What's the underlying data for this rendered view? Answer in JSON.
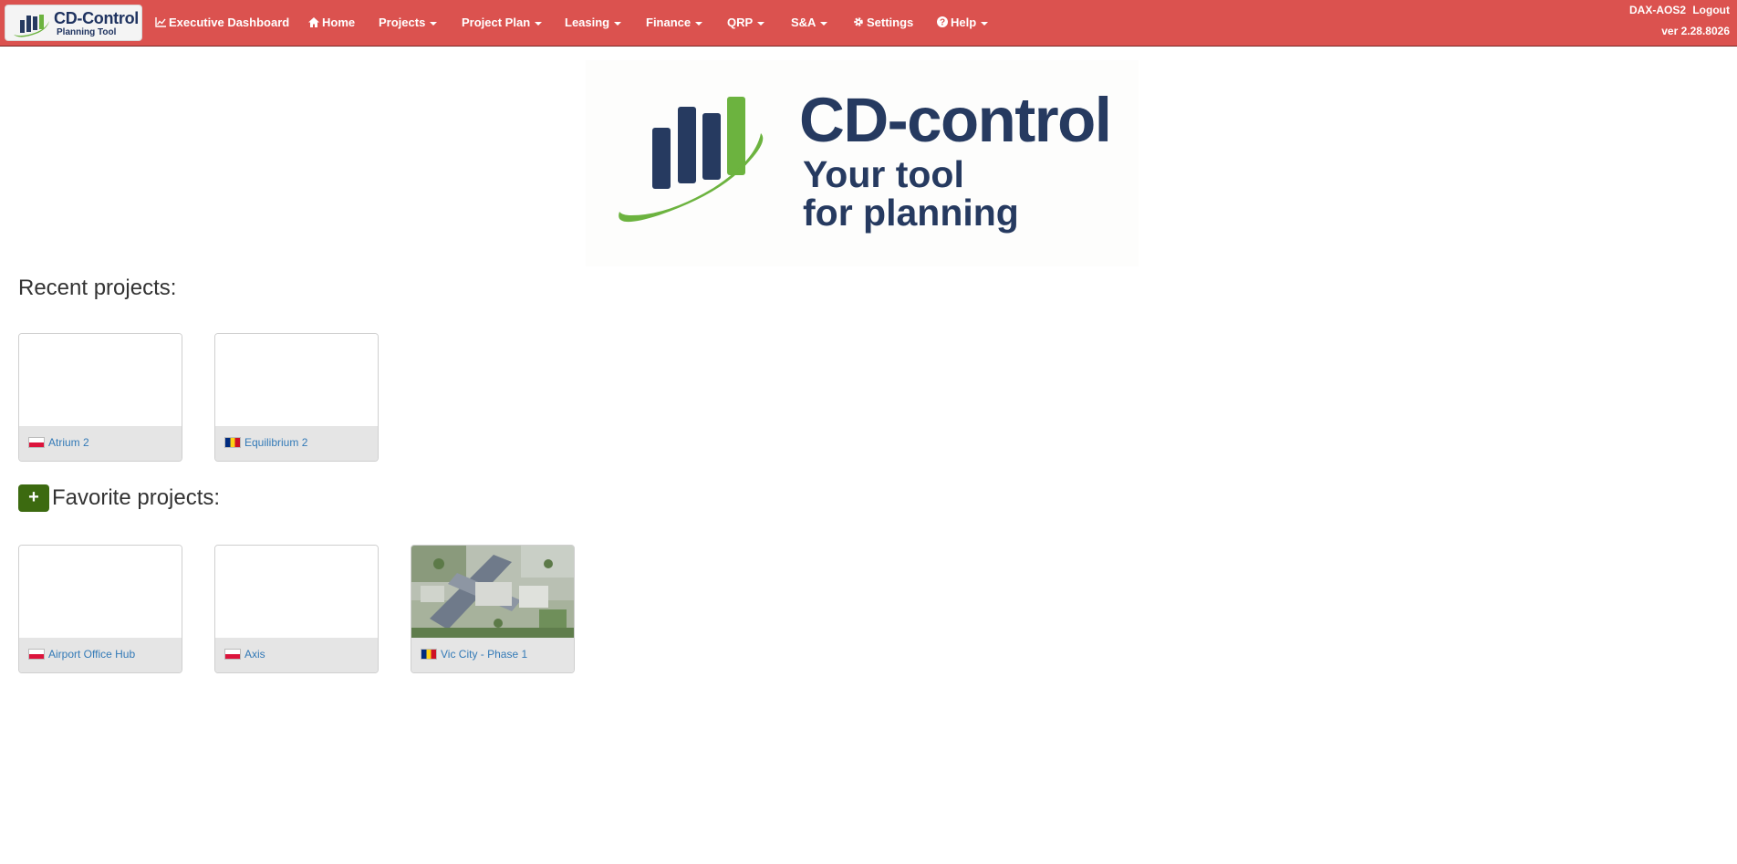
{
  "brand": {
    "title": "CD-Control",
    "subtitle": "Planning Tool"
  },
  "nav": {
    "items": [
      {
        "label": "Executive Dashboard",
        "icon": "chart-icon"
      },
      {
        "label": "Home",
        "icon": "home-icon"
      },
      {
        "label": "Projects",
        "dropdown": true
      },
      {
        "label": "Project Plan",
        "dropdown": true
      },
      {
        "label": "Leasing",
        "dropdown": true
      },
      {
        "label": "Finance",
        "dropdown": true
      },
      {
        "label": "QRP",
        "dropdown": true
      },
      {
        "label": "S&A",
        "dropdown": true
      },
      {
        "label": "Settings",
        "icon": "gear-icon"
      },
      {
        "label": "Help",
        "icon": "question-circle-icon",
        "dropdown": true
      }
    ],
    "user": "DAX-AOS2",
    "logout": "Logout",
    "version": "ver 2.28.8026"
  },
  "hero": {
    "title": "CD-control",
    "tagline_line1": "Your tool",
    "tagline_line2": "for planning"
  },
  "recent": {
    "title": "Recent projects:",
    "projects": [
      {
        "name": "Atrium 2",
        "flag": "pl"
      },
      {
        "name": "Equilibrium 2",
        "flag": "ro"
      }
    ]
  },
  "favorites": {
    "title": "Favorite projects:",
    "add_label": "+",
    "projects": [
      {
        "name": "Airport Office Hub",
        "flag": "pl"
      },
      {
        "name": "Axis",
        "flag": "pl"
      },
      {
        "name": "Vic City - Phase 1",
        "flag": "ro",
        "has_image": true
      }
    ]
  },
  "colors": {
    "navbar": "#db524f",
    "brand_navy": "#263a60",
    "brand_green": "#6cb33f",
    "add_button": "#3c6a10",
    "link": "#337ab7"
  }
}
